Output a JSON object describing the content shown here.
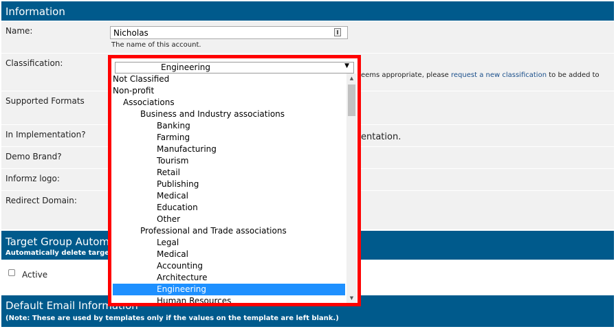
{
  "sections": {
    "information": {
      "title": "Information"
    },
    "target_group": {
      "title": "Target Group Autom",
      "subtitle": "Automatically delete target g"
    },
    "default_email": {
      "title": "Default Email Information",
      "subtitle": "(Note: These are used by templates only if the values on the template are left blank.)"
    }
  },
  "fields": {
    "name": {
      "label": "Name:",
      "value": "Nicholas",
      "hint": "The name of this account."
    },
    "classification": {
      "label": "Classification:",
      "hint_pre": "eems appropriate, please ",
      "hint_link": "request a new classification",
      "hint_post": " to be added to"
    },
    "supported_formats": {
      "label": "Supported Formats"
    },
    "in_implementation": {
      "label": "In Implementation?",
      "trailing_text": "entation."
    },
    "demo_brand": {
      "label": "Demo Brand?"
    },
    "informz_logo": {
      "label": "Informz logo:"
    },
    "redirect_domain": {
      "label": "Redirect Domain:"
    },
    "active": {
      "label": "Active",
      "checked": false
    }
  },
  "dropdown": {
    "selected_value": "Engineering",
    "options": [
      {
        "label": "Not Classified",
        "level": 0
      },
      {
        "label": "Non-profit",
        "level": 0
      },
      {
        "label": "Associations",
        "level": 1
      },
      {
        "label": "Business and Industry associations",
        "level": 2
      },
      {
        "label": "Banking",
        "level": 3
      },
      {
        "label": "Farming",
        "level": 3
      },
      {
        "label": "Manufacturing",
        "level": 3
      },
      {
        "label": "Tourism",
        "level": 3
      },
      {
        "label": "Retail",
        "level": 3
      },
      {
        "label": "Publishing",
        "level": 3
      },
      {
        "label": "Medical",
        "level": 3
      },
      {
        "label": "Education",
        "level": 3
      },
      {
        "label": "Other",
        "level": 3
      },
      {
        "label": "Professional and Trade associations",
        "level": 2
      },
      {
        "label": "Legal",
        "level": 3
      },
      {
        "label": "Medical",
        "level": 3
      },
      {
        "label": "Accounting",
        "level": 3
      },
      {
        "label": "Architecture",
        "level": 3
      },
      {
        "label": "Engineering",
        "level": 3,
        "selected": true
      },
      {
        "label": "Human Resources",
        "level": 3
      }
    ]
  },
  "colors": {
    "header_bg": "#005a8c",
    "highlight_frame": "#ff0000",
    "selected_option": "#1e90ff",
    "row_bg": "#f1f1f1"
  }
}
